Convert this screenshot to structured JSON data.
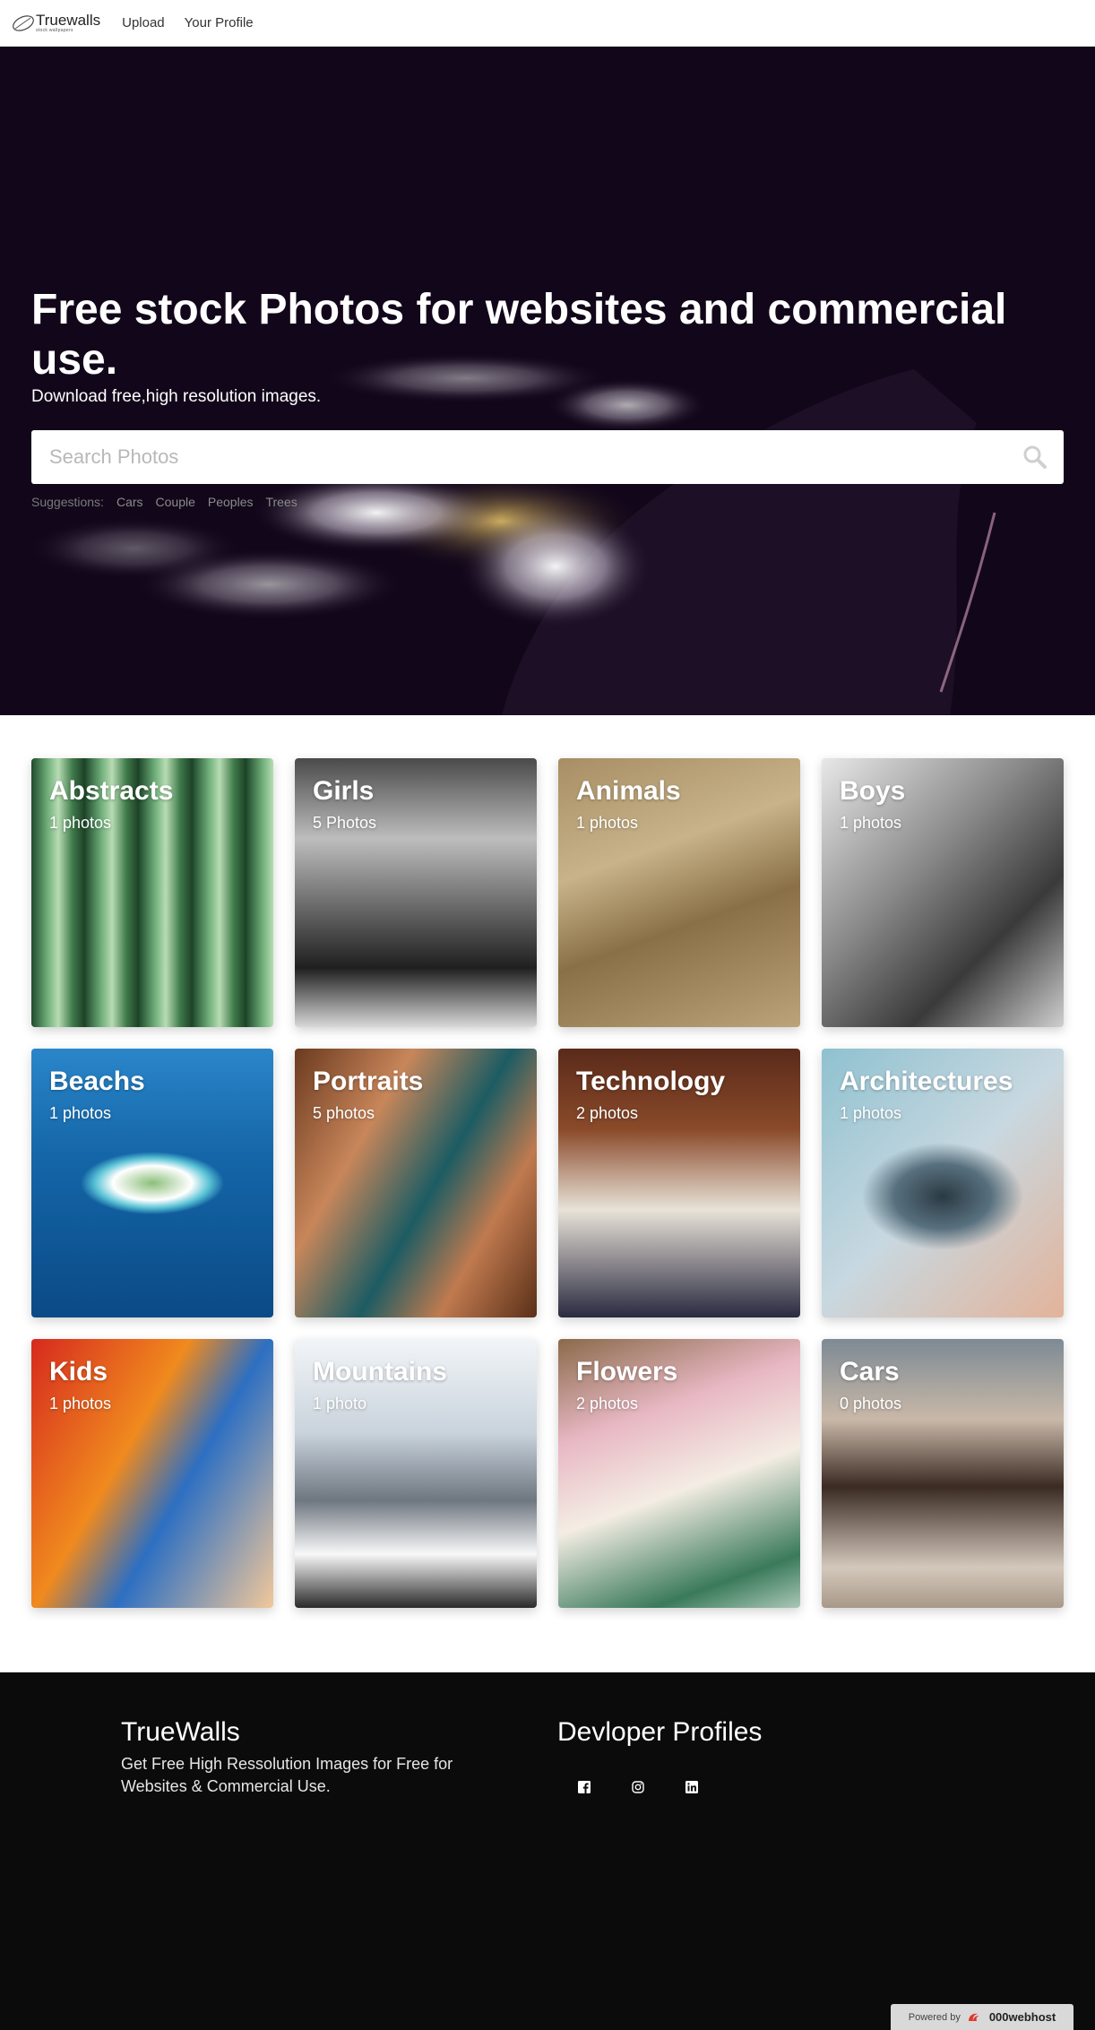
{
  "nav": {
    "logo_name": "Truewalls",
    "logo_tagline": "stock wallpapers",
    "links": [
      "Upload",
      "Your Profile"
    ]
  },
  "hero": {
    "title": "Free stock Photos for websites and commercial use.",
    "subtitle": "Download free,high resolution images.",
    "search_placeholder": "Search Photos",
    "suggestions_label": "Suggestions:",
    "suggestions": [
      "Cars",
      "Couple",
      "Peoples",
      "Trees"
    ]
  },
  "categories": [
    {
      "title": "Abstracts",
      "count": "1 photos"
    },
    {
      "title": "Girls",
      "count": "5 Photos"
    },
    {
      "title": "Animals",
      "count": "1 photos"
    },
    {
      "title": "Boys",
      "count": "1 photos"
    },
    {
      "title": "Beachs",
      "count": "1 photos"
    },
    {
      "title": "Portraits",
      "count": "5 photos"
    },
    {
      "title": "Technology",
      "count": "2 photos"
    },
    {
      "title": "Architectures",
      "count": "1 photos"
    },
    {
      "title": "Kids",
      "count": "1 photos"
    },
    {
      "title": "Mountains",
      "count": "1 photo"
    },
    {
      "title": "Flowers",
      "count": "2 photos"
    },
    {
      "title": "Cars",
      "count": "0 photos"
    }
  ],
  "footer": {
    "brand": "TrueWalls",
    "description": "Get Free High Ressolution Images for Free for Websites & Commercial Use.",
    "dev_title": "Devloper Profiles",
    "social_icons": [
      "facebook-icon",
      "instagram-icon",
      "linkedin-icon"
    ]
  },
  "powered": {
    "label": "Powered by",
    "brand": "000webhost"
  }
}
